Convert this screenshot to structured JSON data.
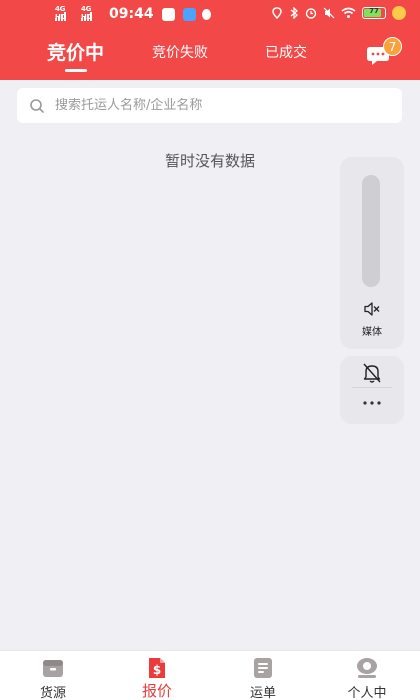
{
  "statusbar": {
    "sim1": "4G HD",
    "sim2": "4G HD",
    "time": "09:44",
    "battery": "77"
  },
  "tabs": [
    {
      "label": "竞价中",
      "active": true
    },
    {
      "label": "竞价失败",
      "active": false
    },
    {
      "label": "已成交",
      "active": false
    }
  ],
  "messages": {
    "badge": "7"
  },
  "search": {
    "placeholder": "搜索托运人名称/企业名称",
    "value": ""
  },
  "empty_text": "暂时没有数据",
  "floating_panel": {
    "media_label": "媒体"
  },
  "bottom_nav": [
    {
      "label": "货源",
      "icon": "box-icon",
      "active": false
    },
    {
      "label": "报价",
      "icon": "quote-dollar-icon",
      "active": true
    },
    {
      "label": "运单",
      "icon": "waybill-icon",
      "active": false
    },
    {
      "label": "个人中",
      "icon": "profile-icon",
      "active": false
    }
  ],
  "colors": {
    "header": "#f24848",
    "accent": "#e93d3d",
    "badge": "#f9a23b",
    "background": "#f0eff4"
  }
}
